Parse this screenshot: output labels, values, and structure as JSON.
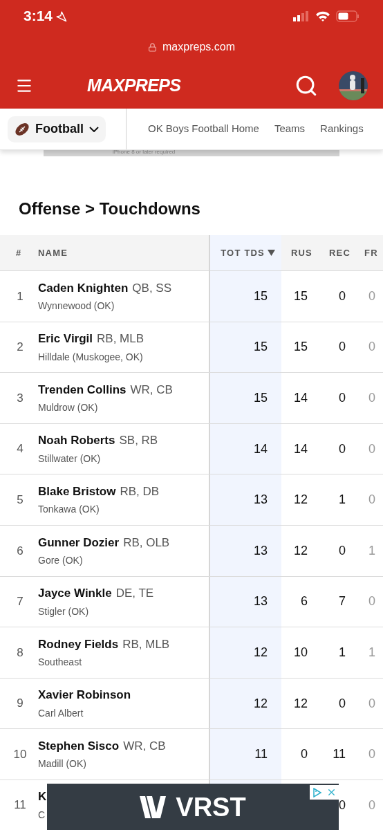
{
  "status_bar": {
    "time": "3:14"
  },
  "browser": {
    "url": "maxpreps.com"
  },
  "header": {
    "logo": "MAXPREPS"
  },
  "subnav": {
    "sport": "Football",
    "links": [
      "OK Boys Football Home",
      "Teams",
      "Rankings"
    ]
  },
  "top_ad": {
    "text": "iPhone 8 or later required"
  },
  "heading": "Offense > Touchdowns",
  "table": {
    "columns": [
      {
        "label": "#",
        "selected": false
      },
      {
        "label": "NAME",
        "selected": false
      },
      {
        "label": "TOT TDS",
        "selected": true
      },
      {
        "label": "RUS",
        "selected": false
      },
      {
        "label": "REC",
        "selected": false
      },
      {
        "label": "FR",
        "selected": false
      }
    ],
    "rows": [
      {
        "rank": "1",
        "name": "Caden Knighten",
        "positions": "QB, SS",
        "school": "Wynnewood (OK)",
        "tot_tds": "15",
        "rus": "15",
        "rec": "0",
        "fr": "0"
      },
      {
        "rank": "2",
        "name": "Eric Virgil",
        "positions": "RB, MLB",
        "school": "Hilldale (Muskogee, OK)",
        "tot_tds": "15",
        "rus": "15",
        "rec": "0",
        "fr": "0"
      },
      {
        "rank": "3",
        "name": "Trenden Collins",
        "positions": "WR, CB",
        "school": "Muldrow (OK)",
        "tot_tds": "15",
        "rus": "14",
        "rec": "0",
        "fr": "0"
      },
      {
        "rank": "4",
        "name": "Noah Roberts",
        "positions": "SB, RB",
        "school": "Stillwater (OK)",
        "tot_tds": "14",
        "rus": "14",
        "rec": "0",
        "fr": "0"
      },
      {
        "rank": "5",
        "name": "Blake Bristow",
        "positions": "RB, DB",
        "school": "Tonkawa (OK)",
        "tot_tds": "13",
        "rus": "12",
        "rec": "1",
        "fr": "0"
      },
      {
        "rank": "6",
        "name": "Gunner Dozier",
        "positions": "RB, OLB",
        "school": "Gore (OK)",
        "tot_tds": "13",
        "rus": "12",
        "rec": "0",
        "fr": "1"
      },
      {
        "rank": "7",
        "name": "Jayce Winkle",
        "positions": "DE, TE",
        "school": "Stigler (OK)",
        "tot_tds": "13",
        "rus": "6",
        "rec": "7",
        "fr": "0"
      },
      {
        "rank": "8",
        "name": "Rodney Fields",
        "positions": "RB, MLB",
        "school": "Southeast",
        "tot_tds": "12",
        "rus": "10",
        "rec": "1",
        "fr": "1"
      },
      {
        "rank": "9",
        "name": "Xavier Robinson",
        "school": "Carl Albert",
        "tot_tds": "12",
        "rus": "12",
        "rec": "0",
        "fr": "0"
      },
      {
        "rank": "10",
        "name": "Stephen Sisco",
        "positions": "WR, CB",
        "school": "Madill (OK)",
        "tot_tds": "11",
        "rus": "0",
        "rec": "11",
        "fr": "0"
      },
      {
        "rank": "11",
        "name": "K",
        "school": "C",
        "rec": "0",
        "fr": "0"
      }
    ]
  },
  "bottom_ad": {
    "brand": "VRST"
  }
}
